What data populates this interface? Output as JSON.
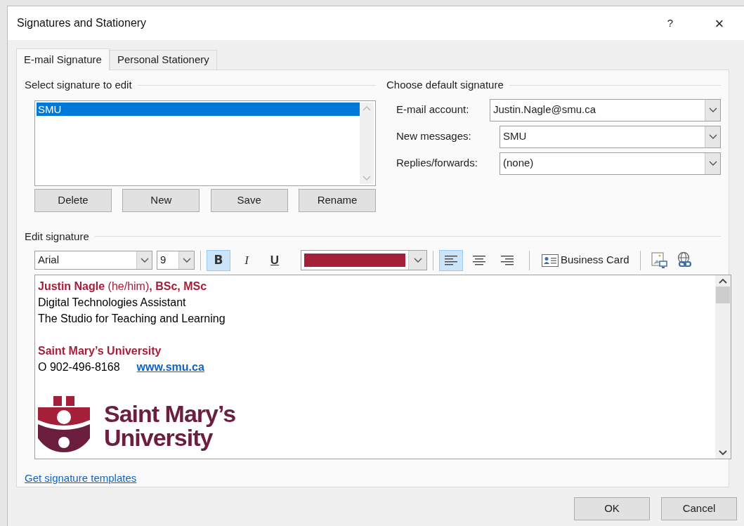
{
  "window": {
    "title": "Signatures and Stationery",
    "help": "?",
    "close": "×"
  },
  "tabs": [
    {
      "label": "E-mail Signature",
      "selected": true
    },
    {
      "label": "Personal Stationery",
      "selected": false
    }
  ],
  "select_group": {
    "title": "Select signature to edit",
    "items": [
      {
        "label": "SMU",
        "selected": true
      }
    ],
    "buttons": [
      "Delete",
      "New",
      "Save",
      "Rename"
    ]
  },
  "default_group": {
    "title": "Choose default signature",
    "fields": [
      {
        "label": "E-mail account:",
        "value": "Justin.Nagle@smu.ca"
      },
      {
        "label": "New messages:",
        "value": "SMU"
      },
      {
        "label": "Replies/forwards:",
        "value": "(none)"
      }
    ]
  },
  "edit_group": {
    "title": "Edit signature"
  },
  "toolbar": {
    "font": "Arial",
    "size": "9",
    "bold": true,
    "italic": false,
    "underline": false,
    "color": "#a4203a",
    "alignment": [
      {
        "kind": "left",
        "selected": true
      },
      {
        "kind": "center",
        "selected": false
      },
      {
        "kind": "right",
        "selected": false
      }
    ],
    "bold_label": "B",
    "italic_label": "I",
    "underline_label": "U",
    "business_card": "Business Card"
  },
  "signature": {
    "lines": [
      {
        "kind": "heading",
        "text": "**Justin Nagle** (he/him)**, BSc, MSc**"
      },
      {
        "kind": "plain",
        "text": "Digital Technologies Assistant"
      },
      {
        "kind": "plain",
        "text": "The Studio for Teaching and Learning"
      },
      {
        "kind": "blank"
      },
      {
        "kind": "heading",
        "text": "**Saint Mary’s University**"
      },
      {
        "kind": "contact",
        "text": "O 902-496-8168",
        "link": "www.smu.ca"
      },
      {
        "kind": "logo",
        "line1": "Saint Mary’s",
        "line2": "University"
      }
    ]
  },
  "templates_link": "Get signature templates",
  "footer_buttons": [
    "OK",
    "Cancel"
  ]
}
